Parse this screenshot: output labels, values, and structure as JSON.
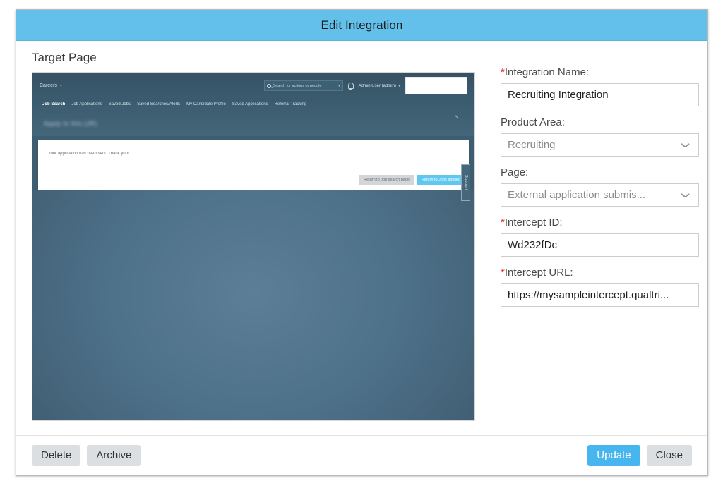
{
  "dialog": {
    "title": "Edit Integration",
    "header_color": "#62c0ea"
  },
  "target_page": {
    "section_label": "Target Page",
    "preview": {
      "brand": "Careers",
      "brand_caret": "chevron-down-icon",
      "search_placeholder": "Search for actions or people",
      "notification_icon": "bell-icon",
      "user": "Admin User (admin)",
      "user_caret": "chevron-down-icon",
      "nav_items": [
        "Job Search",
        "Job Applications",
        "Saved Jobs",
        "Saved Searches/Alerts",
        "My Candidate Profile",
        "Saved Applications",
        "Referral Tracking"
      ],
      "active_nav": "Job Search",
      "page_title": "Apply to this (JR)",
      "collapse_icon": "chevron-up-icon",
      "card_message": "Your application has been sent. Thank you!",
      "card_buttons": [
        {
          "label": "Return to Job search page",
          "style": "secondary"
        },
        {
          "label": "Return to Jobs applied",
          "style": "primary"
        }
      ],
      "support_tab": "Support"
    }
  },
  "form": {
    "integration_name": {
      "label": "Integration Name:",
      "required": true,
      "value": "Recruiting Integration"
    },
    "product_area": {
      "label": "Product Area:",
      "required": false,
      "value": "Recruiting"
    },
    "page": {
      "label": "Page:",
      "required": false,
      "value": "External application submis..."
    },
    "intercept_id": {
      "label": "Intercept ID:",
      "required": true,
      "value": "Wd232fDc"
    },
    "intercept_url": {
      "label": "Intercept URL:",
      "required": true,
      "value": "https://mysampleintercept.qualtri..."
    },
    "required_marker": "*"
  },
  "footer": {
    "delete_label": "Delete",
    "archive_label": "Archive",
    "update_label": "Update",
    "close_label": "Close",
    "primary_color": "#47b6ee"
  }
}
